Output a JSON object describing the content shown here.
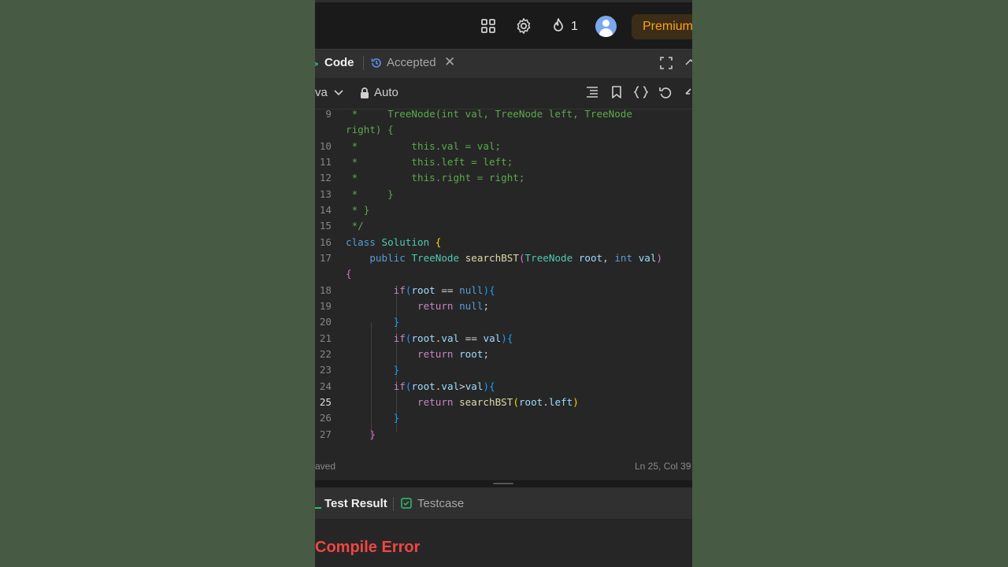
{
  "topbar": {
    "streak_count": "1",
    "premium_label": "Premium"
  },
  "tabs": {
    "code_label": "Code",
    "accepted_label": "Accepted"
  },
  "toolbar": {
    "language": "va",
    "auto_label": "Auto"
  },
  "code_lines": [
    {
      "n": "9",
      "text": " *     TreeNode(int val, TreeNode left, TreeNode"
    },
    {
      "n": "",
      "text": "right) {"
    },
    {
      "n": "10",
      "text": " *         this.val = val;"
    },
    {
      "n": "11",
      "text": " *         this.left = left;"
    },
    {
      "n": "12",
      "text": " *         this.right = right;"
    },
    {
      "n": "13",
      "text": " *     }"
    },
    {
      "n": "14",
      "text": " * }"
    },
    {
      "n": "15",
      "text": " */"
    },
    {
      "n": "16",
      "text": "class Solution {"
    },
    {
      "n": "17",
      "text": "    public TreeNode searchBST(TreeNode root, int val)"
    },
    {
      "n": "",
      "text": "{"
    },
    {
      "n": "18",
      "text": "        if(root == null){"
    },
    {
      "n": "19",
      "text": "            return null;"
    },
    {
      "n": "20",
      "text": "        }"
    },
    {
      "n": "21",
      "text": "        if(root.val == val){"
    },
    {
      "n": "22",
      "text": "            return root;"
    },
    {
      "n": "23",
      "text": "        }"
    },
    {
      "n": "24",
      "text": "        if(root.val>val){"
    },
    {
      "n": "25",
      "text": "            return searchBST(root.left)"
    },
    {
      "n": "26",
      "text": "        }"
    },
    {
      "n": "27",
      "text": "    }"
    }
  ],
  "active_line": "25",
  "status": {
    "saved": "aved",
    "position": "Ln 25, Col 39"
  },
  "result": {
    "test_result_label": "Test Result",
    "testcase_label": "Testcase",
    "compile_error": "Compile Error"
  },
  "colors": {
    "accent_orange": "#ffa116",
    "error_red": "#ef4743",
    "success_green": "#2fbf71",
    "comment_green": "#5aaa4a"
  },
  "icons": [
    "layout-grid-icon",
    "gear-icon",
    "fire-icon",
    "avatar",
    "code-icon",
    "history-icon",
    "close-icon",
    "expand-icon",
    "chevron-down-icon",
    "lock-icon",
    "format-icon",
    "bookmark-icon",
    "braces-icon",
    "undo-icon",
    "checkbox-icon"
  ]
}
